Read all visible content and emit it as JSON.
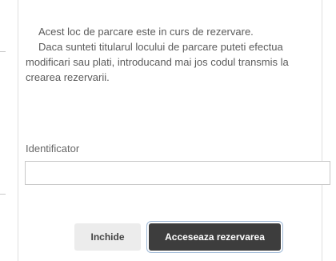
{
  "dialog": {
    "message_line1": "Acest loc de parcare este in curs de rezervare.",
    "message_line2": "Daca sunteti titularul locului de parcare puteti efectua modificari sau plati, introducand mai jos codul transmis la crearea rezervarii.",
    "identifier_label": "Identificator",
    "identifier_value": "",
    "identifier_placeholder": "",
    "cancel_label": "Inchide",
    "confirm_label": "Acceseaza rezervarea"
  },
  "colors": {
    "primary_button": "#3d3d3d",
    "secondary_button": "#ececec",
    "focus_ring": "#9fb9d6"
  }
}
